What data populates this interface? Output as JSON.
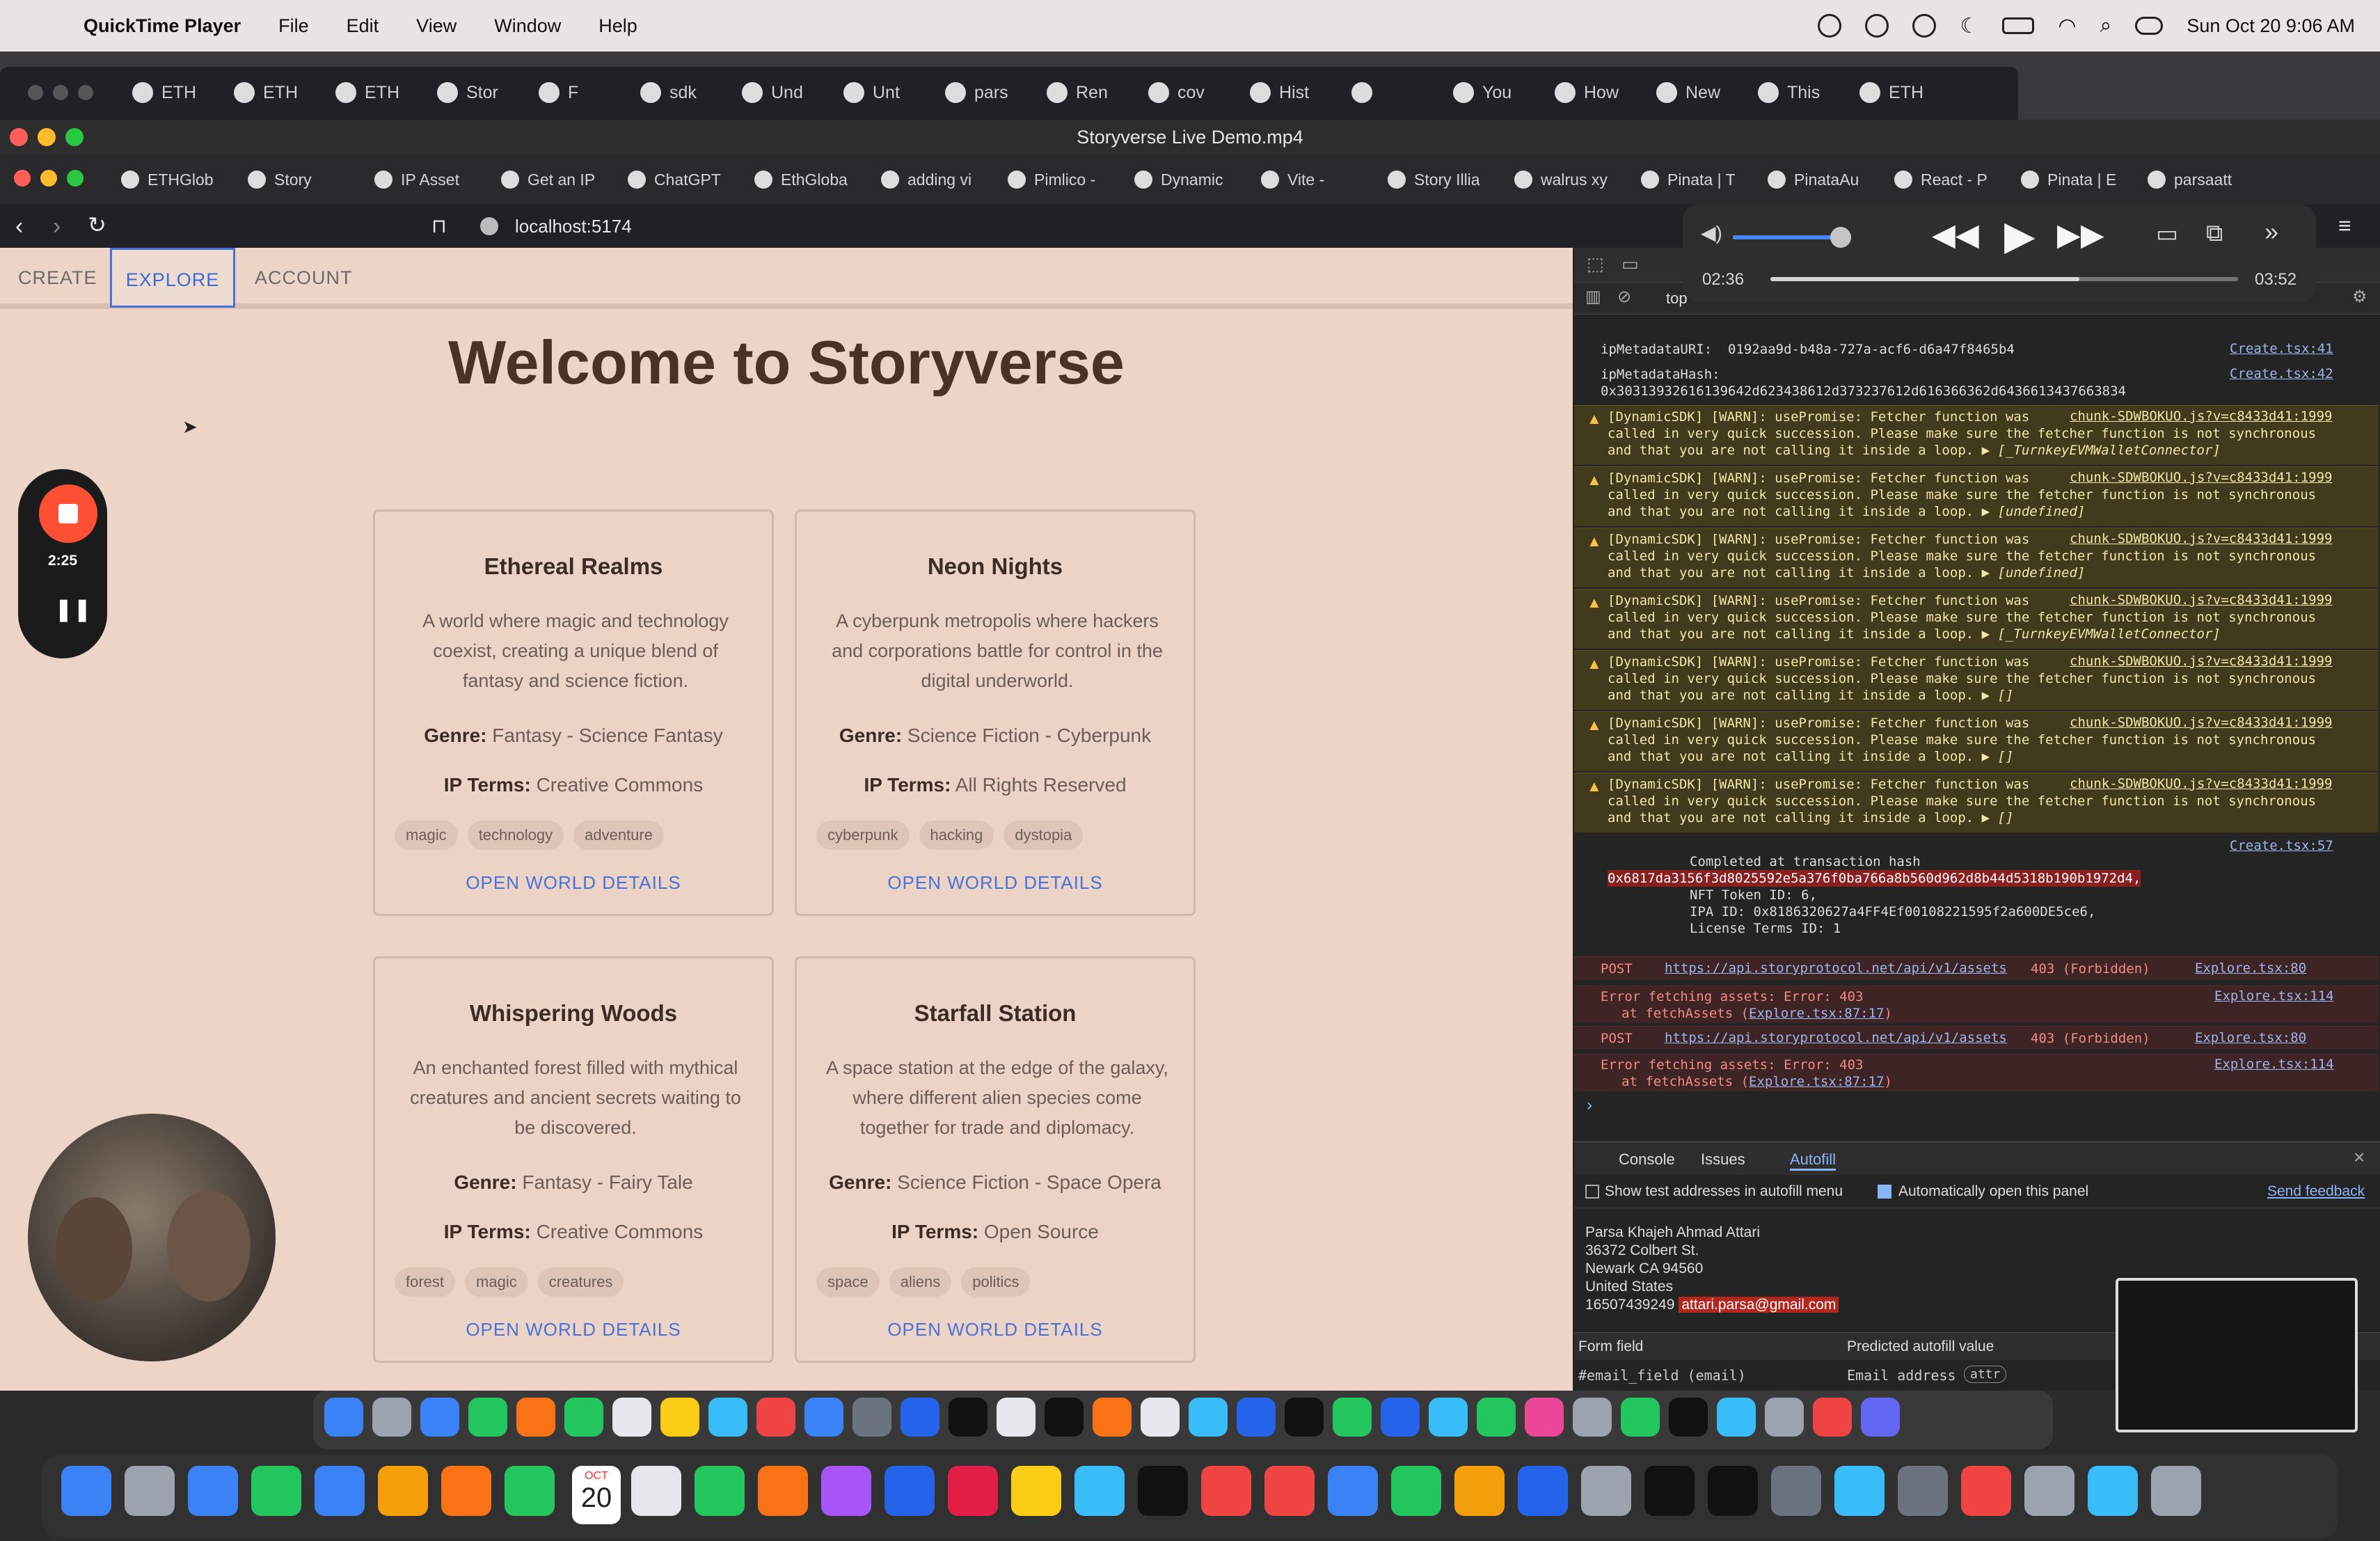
{
  "menubar": {
    "app": "QuickTime Player",
    "items": [
      "File",
      "Edit",
      "View",
      "Window",
      "Help"
    ],
    "clock": "Sun Oct 20  9:06 AM"
  },
  "outer_tabs": [
    "ETH",
    "ETH",
    "ETH",
    "Stor",
    "F",
    "sdk",
    "Und",
    "Unt",
    "pars",
    "Ren",
    "cov",
    "Hist",
    "",
    "You",
    "How",
    "New",
    "This",
    "ETH"
  ],
  "window_title": "Storyverse Live Demo.mp4",
  "inner_tabs": [
    "ETHGlob",
    "Story",
    "IP Asset",
    "Get an IP",
    "ChatGPT",
    "EthGloba",
    "adding vi",
    "Pimlico -",
    "Dynamic",
    "Vite -",
    "Story Illia",
    "walrus xy",
    "Pinata | T",
    "PinataAu",
    "React - P",
    "Pinata | E",
    "parsaatt"
  ],
  "address": "localhost:5174",
  "nav": {
    "create": "CREATE",
    "explore": "EXPLORE",
    "account": "ACCOUNT"
  },
  "heading": "Welcome to Storyverse",
  "recorder_time": "2:25",
  "labels": {
    "genre": "Genre:",
    "terms": "IP Terms:",
    "open": "OPEN WORLD DETAILS"
  },
  "cards": [
    {
      "title": "Ethereal Realms",
      "desc": "A world where magic and technology coexist, creating a unique blend of fantasy and science fiction.",
      "genre": " Fantasy - Science Fantasy",
      "terms": " Creative Commons",
      "tags": [
        "magic",
        "technology",
        "adventure"
      ]
    },
    {
      "title": "Neon Nights",
      "desc": "A cyberpunk metropolis where hackers and corporations battle for control in the digital underworld.",
      "genre": " Science Fiction - Cyberpunk",
      "terms": " All Rights Reserved",
      "tags": [
        "cyberpunk",
        "hacking",
        "dystopia"
      ]
    },
    {
      "title": "Whispering Woods",
      "desc": "An enchanted forest filled with mythical creatures and ancient secrets waiting to be discovered.",
      "genre": " Fantasy - Fairy Tale",
      "terms": " Creative Commons",
      "tags": [
        "forest",
        "magic",
        "creatures"
      ]
    },
    {
      "title": "Starfall Station",
      "desc": "A space station at the edge of the galaxy, where different alien species come together for trade and diplomacy.",
      "genre": " Science Fiction - Space Opera",
      "terms": " Open Source",
      "tags": [
        "space",
        "aliens",
        "politics"
      ]
    }
  ],
  "qt": {
    "elapsed": "02:36",
    "total": "03:52",
    "progress": 0.66
  },
  "devtools": {
    "context": "top",
    "meta_uri": "ipMetadataURI:  0192aa9d-b48a-727a-acf6-d6a47f8465b4",
    "meta_hash_label": "ipMetadataHash:",
    "meta_hash": "0x30313932616139642d623438612d373237612d616366362d6436613437663834",
    "create41": "Create.tsx:41",
    "create42": "Create.tsx:42",
    "create57": "Create.tsx:57",
    "warn_line1": "[DynamicSDK] [WARN]: usePromise: Fetcher function was",
    "warn_src": "chunk-SDWBOKUO.js?v=c8433d41:1999",
    "warn_line2": "called in very quick succession. Please make sure the fetcher function is not synchronous",
    "warn_line3_prefix": "and that you are not calling it inside a loop.",
    "warn_tails": [
      "[_TurnkeyEVMWalletConnector]",
      "[undefined]",
      "[undefined]",
      "[_TurnkeyEVMWalletConnector]",
      "[]",
      "[]",
      "[]"
    ],
    "completed": "Completed at transaction hash",
    "tx_hash": "0x6817da3156f3d8025592e5a376f0ba766a8b560d962d8b44d5318b190b1972d4,",
    "nft": "NFT Token ID: 6,",
    "ipa": "IPA ID: 0x8186320627a4FF4Ef00108221595f2a600DE5ce6,",
    "license": "License Terms ID: 1",
    "post": "POST",
    "post_url": "https://api.storyprotocol.net/api/v1/assets",
    "forbidden": "403 (Forbidden)",
    "explore80": "Explore.tsx:80",
    "explore114": "Explore.tsx:114",
    "err_fetch": "Error fetching assets: Error: 403",
    "err_at": "at fetchAssets (",
    "err_src": "Explore.tsx:87:17",
    "err_close": ")",
    "drawer_tabs": [
      "Console",
      "Issues",
      "Autofill"
    ],
    "show_test": "Show test addresses in autofill menu",
    "auto_open": "Automatically open this panel",
    "send_feedback": "Send feedback",
    "address_lines": [
      "Parsa Khajeh Ahmad Attari",
      "36372 Colbert St.",
      "Newark CA 94560",
      "United States",
      "16507439249"
    ],
    "email": "attari.parsa@gmail.com",
    "form_field": "Form field",
    "predicted": "Predicted autofill value",
    "field_val": "#email_field (email)",
    "pred_val": "Email address",
    "pred_tag": "attr"
  },
  "dock_calendar": {
    "month": "OCT",
    "day": "20"
  }
}
